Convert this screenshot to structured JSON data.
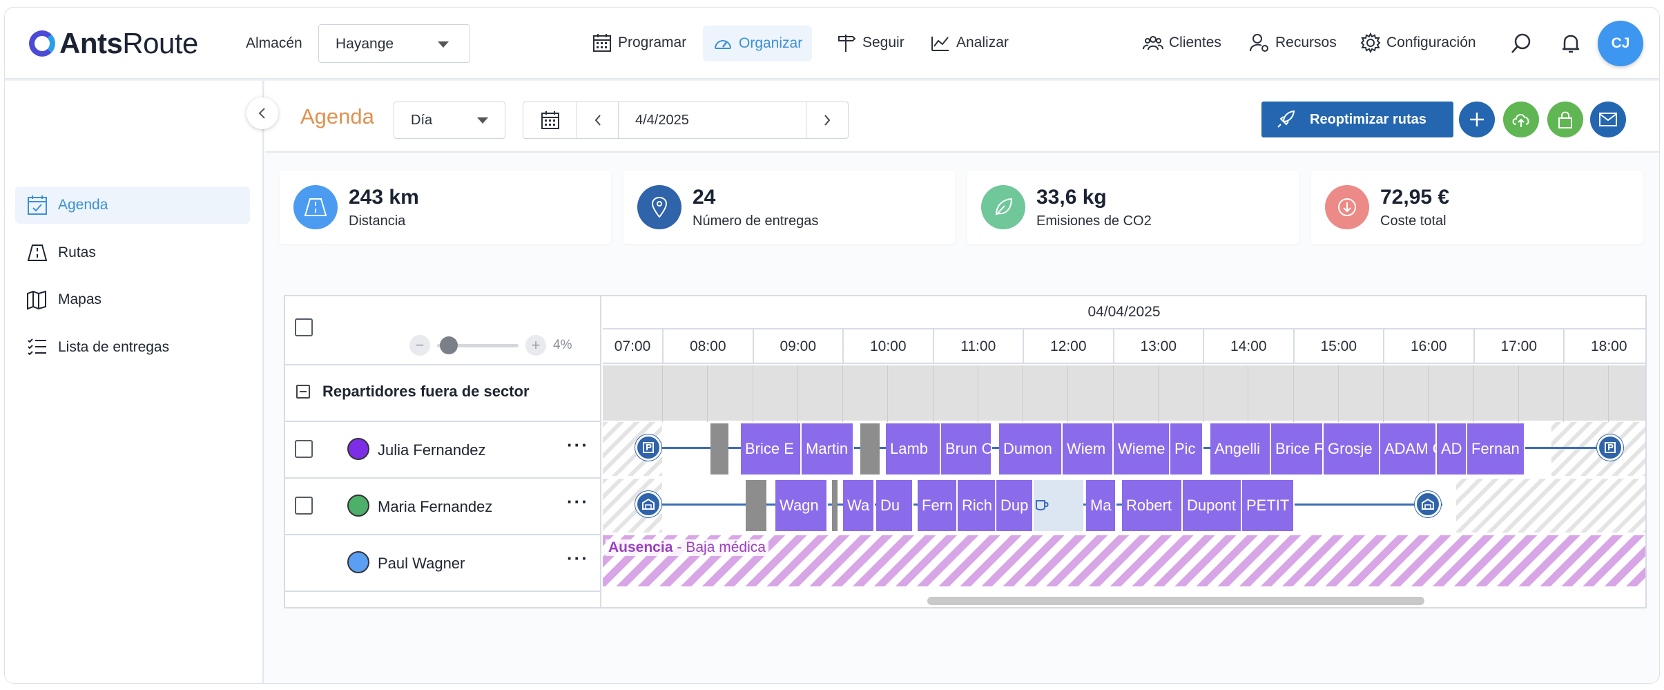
{
  "app": {
    "logo_bold": "Ants",
    "logo_light": "Route",
    "avatar_initials": "CJ"
  },
  "topbar": {
    "warehouse_label": "Almacén",
    "warehouse_value": "Hayange",
    "nav": {
      "plan": "Programar",
      "organize": "Organizar",
      "track": "Seguir",
      "analyze": "Analizar"
    },
    "right": {
      "clients": "Clientes",
      "resources": "Recursos",
      "settings": "Configuración"
    }
  },
  "sidebar": {
    "agenda": "Agenda",
    "routes": "Rutas",
    "maps": "Mapas",
    "deliveries": "Lista de entregas"
  },
  "subheader": {
    "title": "Agenda",
    "view": "Día",
    "date": "4/4/2025",
    "reoptimize": "Reoptimizar rutas"
  },
  "kpis": {
    "distance": {
      "value": "243 km",
      "label": "Distancia"
    },
    "deliveries": {
      "value": "24",
      "label": "Número de entregas"
    },
    "co2": {
      "value": "33,6 kg",
      "label": "Emisiones de CO2"
    },
    "cost": {
      "value": "72,95 €",
      "label": "Coste total"
    }
  },
  "gantt": {
    "zoom": "4%",
    "date": "04/04/2025",
    "hours": [
      "07:00",
      "08:00",
      "09:00",
      "10:00",
      "11:00",
      "12:00",
      "13:00",
      "14:00",
      "15:00",
      "16:00",
      "17:00",
      "18:00"
    ],
    "sector_label": "Repartidores fuera de sector",
    "drivers": [
      {
        "name": "Julia Fernandez",
        "color": "#7c2ee6"
      },
      {
        "name": "Maria Fernandez",
        "color": "#4caf6a"
      },
      {
        "name": "Paul Wagner",
        "color": "#5b9ff5"
      }
    ],
    "row1_tasks": [
      "Brice E",
      "Martin",
      "Lamb",
      "Brun C",
      "Dumon",
      "Wiem",
      "Wieme",
      "Pic",
      "Angelli",
      "Brice F",
      "Grosje",
      "ADAM C",
      "AD",
      "Fernan"
    ],
    "row2_tasks": [
      "Wagn",
      "Wa",
      "Du",
      "Fern",
      "Rich",
      "Dup",
      "Ma",
      "Robert",
      "Dupont",
      "PETIT"
    ],
    "absence_title": "Ausencia",
    "absence_sep": "-",
    "absence_reason": "Baja médica"
  },
  "colors": {
    "accent": "#3a8fd6",
    "primary": "#2467b0",
    "task": "#8a6bea",
    "agenda_title": "#e09150"
  }
}
